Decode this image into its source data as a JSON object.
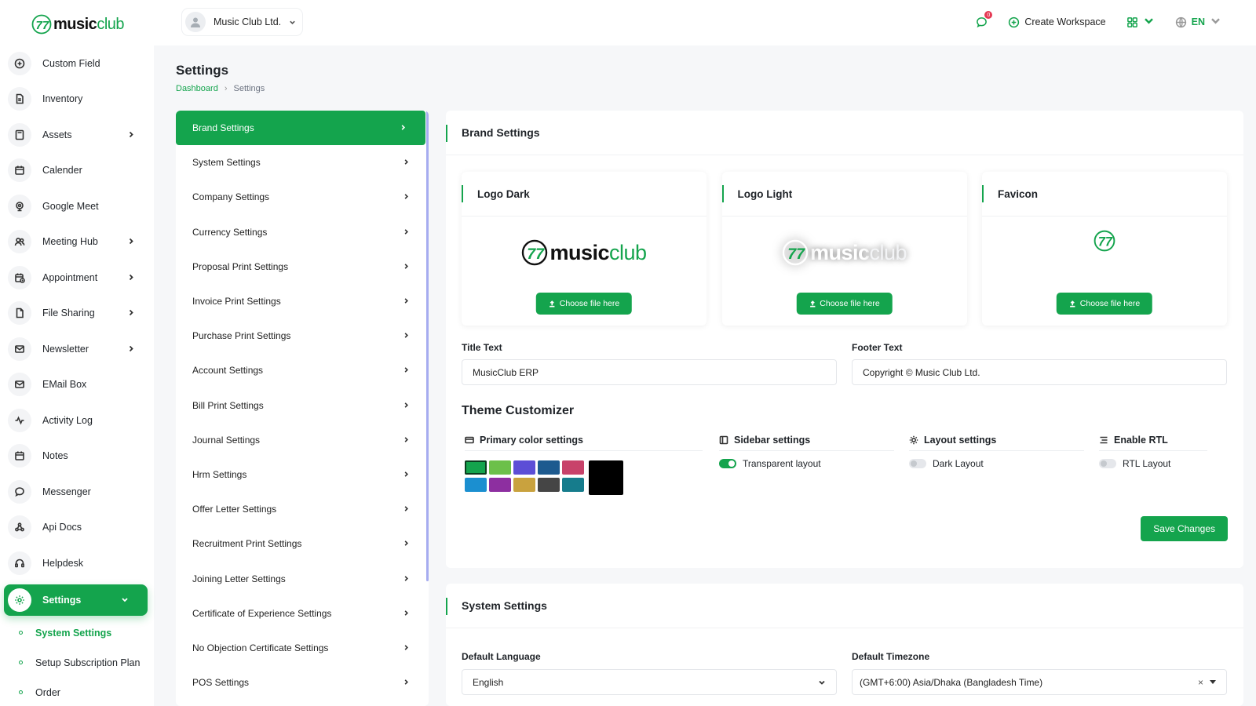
{
  "brand": {
    "name_bold": "music",
    "name_thin": "club"
  },
  "header": {
    "workspace": "Music Club Ltd.",
    "notification_count": "0",
    "create_workspace": "Create Workspace",
    "language": "EN"
  },
  "sidebar": {
    "items": [
      {
        "label": "Custom Field",
        "icon": "plus-circle-icon",
        "chevron": false
      },
      {
        "label": "Inventory",
        "icon": "document-icon",
        "chevron": false
      },
      {
        "label": "Assets",
        "icon": "calculator-icon",
        "chevron": true
      },
      {
        "label": "Calender",
        "icon": "calendar-icon",
        "chevron": false
      },
      {
        "label": "Google Meet",
        "icon": "webcam-icon",
        "chevron": false
      },
      {
        "label": "Meeting Hub",
        "icon": "users-icon",
        "chevron": true
      },
      {
        "label": "Appointment",
        "icon": "calendar-clock-icon",
        "chevron": true
      },
      {
        "label": "File Sharing",
        "icon": "file-icon",
        "chevron": true
      },
      {
        "label": "Newsletter",
        "icon": "mail-icon",
        "chevron": true
      },
      {
        "label": "EMail Box",
        "icon": "mail-icon",
        "chevron": false
      },
      {
        "label": "Activity Log",
        "icon": "activity-icon",
        "chevron": false
      },
      {
        "label": "Notes",
        "icon": "calendar-icon",
        "chevron": false
      },
      {
        "label": "Messenger",
        "icon": "message-icon",
        "chevron": false
      },
      {
        "label": "Api Docs",
        "icon": "webhook-icon",
        "chevron": false
      },
      {
        "label": "Helpdesk",
        "icon": "headset-icon",
        "chevron": false
      }
    ],
    "active": {
      "label": "Settings",
      "icon": "gear-icon"
    },
    "sub_items": [
      {
        "label": "System Settings",
        "active": true
      },
      {
        "label": "Setup Subscription Plan",
        "active": false
      },
      {
        "label": "Order",
        "active": false
      }
    ]
  },
  "page": {
    "title": "Settings",
    "breadcrumb": {
      "home": "Dashboard",
      "current": "Settings"
    }
  },
  "settings_menu": [
    "Brand Settings",
    "System Settings",
    "Company Settings",
    "Currency Settings",
    "Proposal Print Settings",
    "Invoice Print Settings",
    "Purchase Print Settings",
    "Account Settings",
    "Bill Print Settings",
    "Journal Settings",
    "Hrm Settings",
    "Offer Letter Settings",
    "Recruitment Print Settings",
    "Joining Letter Settings",
    "Certificate of Experience Settings",
    "No Objection Certificate Settings",
    "POS Settings"
  ],
  "brand_settings": {
    "title": "Brand Settings",
    "cards": [
      {
        "title": "Logo Dark",
        "button": "Choose file here"
      },
      {
        "title": "Logo Light",
        "button": "Choose file here"
      },
      {
        "title": "Favicon",
        "button": "Choose file here"
      }
    ],
    "title_text": {
      "label": "Title Text",
      "value": "MusicClub ERP"
    },
    "footer_text": {
      "label": "Footer Text",
      "value": "Copyright © Music Club Ltd."
    },
    "theme": {
      "title": "Theme Customizer",
      "primary_color": "Primary color settings",
      "sidebar": {
        "label": "Sidebar settings",
        "toggle": "Transparent layout",
        "on": true
      },
      "layout": {
        "label": "Layout settings",
        "toggle": "Dark Layout",
        "on": false
      },
      "rtl": {
        "label": "Enable RTL",
        "toggle": "RTL Layout",
        "on": false
      },
      "swatches": [
        "#14a44d",
        "#6cc04a",
        "#5c4ed6",
        "#1d5a8f",
        "#c8426a",
        "#1b8fd0",
        "#8d2fa0",
        "#c9a23e",
        "#454545",
        "#167c8c"
      ],
      "custom_color": "#000000"
    },
    "save": "Save Changes"
  },
  "system_settings": {
    "title": "System Settings",
    "language": {
      "label": "Default Language",
      "value": "English"
    },
    "timezone": {
      "label": "Default Timezone",
      "value": "(GMT+6:00) Asia/Dhaka (Bangladesh Time)"
    }
  },
  "colors": {
    "accent": "#14a44d",
    "scrollbar": "#a6acf0"
  }
}
